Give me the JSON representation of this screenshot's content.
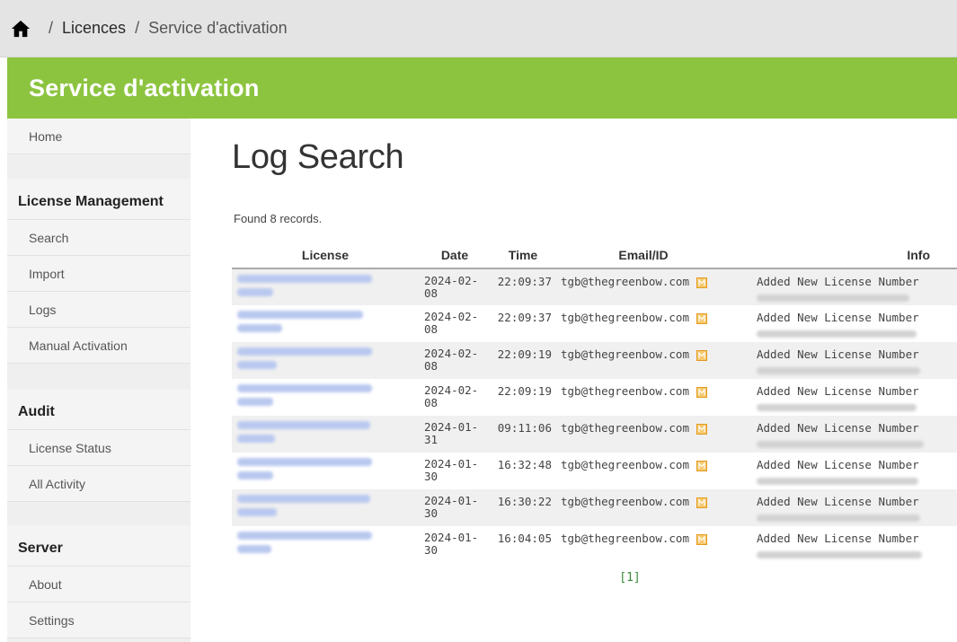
{
  "breadcrumb": {
    "home_icon": "home-icon",
    "separator": "/",
    "items": [
      "Licences",
      "Service d'activation"
    ]
  },
  "banner": {
    "title": "Service d'activation",
    "color": "#8cc43f"
  },
  "sidebar": {
    "home": "Home",
    "sections": [
      {
        "heading": "License Management",
        "items": [
          "Search",
          "Import",
          "Logs",
          "Manual Activation"
        ]
      },
      {
        "heading": "Audit",
        "items": [
          "License Status",
          "All Activity"
        ]
      },
      {
        "heading": "Server",
        "items": [
          "About",
          "Settings"
        ]
      }
    ]
  },
  "main": {
    "title": "Log Search",
    "found_text": "Found 8 records.",
    "columns": [
      "License",
      "Date",
      "Time",
      "Email/ID",
      "Info"
    ],
    "rows": [
      {
        "date": "2024-02-08",
        "time": "22:09:37",
        "email": "tgb@thegreenbow.com",
        "info": "Added New License Number"
      },
      {
        "date": "2024-02-08",
        "time": "22:09:37",
        "email": "tgb@thegreenbow.com",
        "info": "Added New License Number"
      },
      {
        "date": "2024-02-08",
        "time": "22:09:19",
        "email": "tgb@thegreenbow.com",
        "info": "Added New License Number"
      },
      {
        "date": "2024-02-08",
        "time": "22:09:19",
        "email": "tgb@thegreenbow.com",
        "info": "Added New License Number"
      },
      {
        "date": "2024-01-31",
        "time": "09:11:06",
        "email": "tgb@thegreenbow.com",
        "info": "Added New License Number"
      },
      {
        "date": "2024-01-30",
        "time": "16:32:48",
        "email": "tgb@thegreenbow.com",
        "info": "Added New License Number"
      },
      {
        "date": "2024-01-30",
        "time": "16:30:22",
        "email": "tgb@thegreenbow.com",
        "info": "Added New License Number"
      },
      {
        "date": "2024-01-30",
        "time": "16:04:05",
        "email": "tgb@thegreenbow.com",
        "info": "Added New License Number"
      }
    ],
    "mail_icon": "mail-icon",
    "pagination": "[1]"
  }
}
